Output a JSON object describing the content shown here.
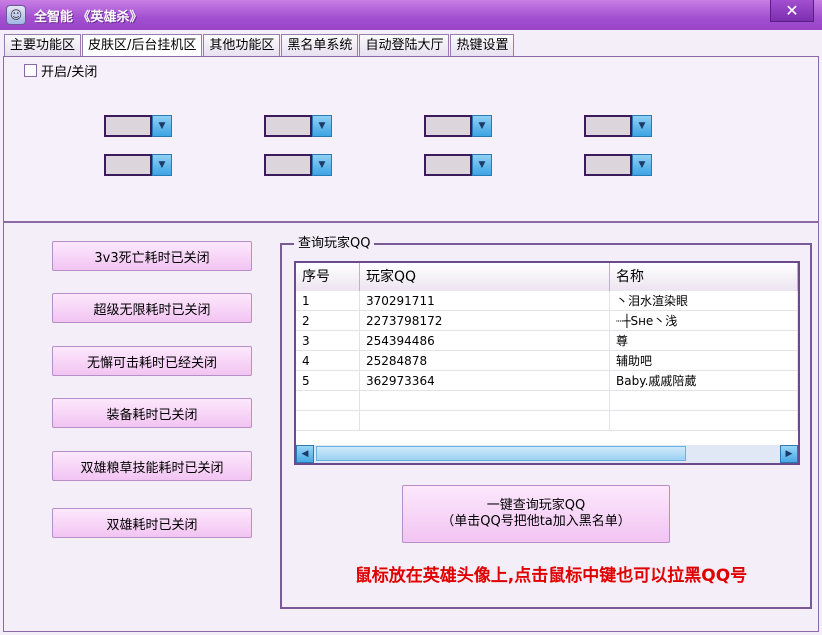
{
  "window": {
    "title": "全智能 《英雄杀》",
    "close_label": "✕"
  },
  "tabs": [
    {
      "label": "主要功能区"
    },
    {
      "label": "皮肤区/后台挂机区"
    },
    {
      "label": "其他功能区"
    },
    {
      "label": "黑名单系统"
    },
    {
      "label": "自动登陆大厅"
    },
    {
      "label": "热键设置"
    }
  ],
  "top_panel": {
    "enable_label": "开启/关闭",
    "enable_checked": false
  },
  "side_buttons": [
    {
      "label": "3v3死亡耗时已关闭"
    },
    {
      "label": "超级无限耗时已关闭"
    },
    {
      "label": "无懈可击耗时已经关闭"
    },
    {
      "label": "装备耗时已关闭"
    },
    {
      "label": "双雄粮草技能耗时已关闭"
    },
    {
      "label": "双雄耗时已关闭"
    }
  ],
  "query_group": {
    "title": "查询玩家QQ",
    "columns": [
      "序号",
      "玩家QQ",
      "名称"
    ],
    "rows": [
      [
        "1",
        "370291711",
        "丶泪水渲染眼"
      ],
      [
        "2",
        "2273798172",
        "┈┼Sне丶浅"
      ],
      [
        "3",
        "254394486",
        "尊"
      ],
      [
        "4",
        "25284878",
        "辅助吧"
      ],
      [
        "5",
        "362973364",
        "Baby.戚戚陪葳"
      ]
    ],
    "query_button_line1": "一键查询玩家QQ",
    "query_button_line2": "（单击QQ号把他ta加入黑名单）",
    "hint": "鼠标放在英雄头像上,点击鼠标中键也可以拉黑QQ号"
  }
}
